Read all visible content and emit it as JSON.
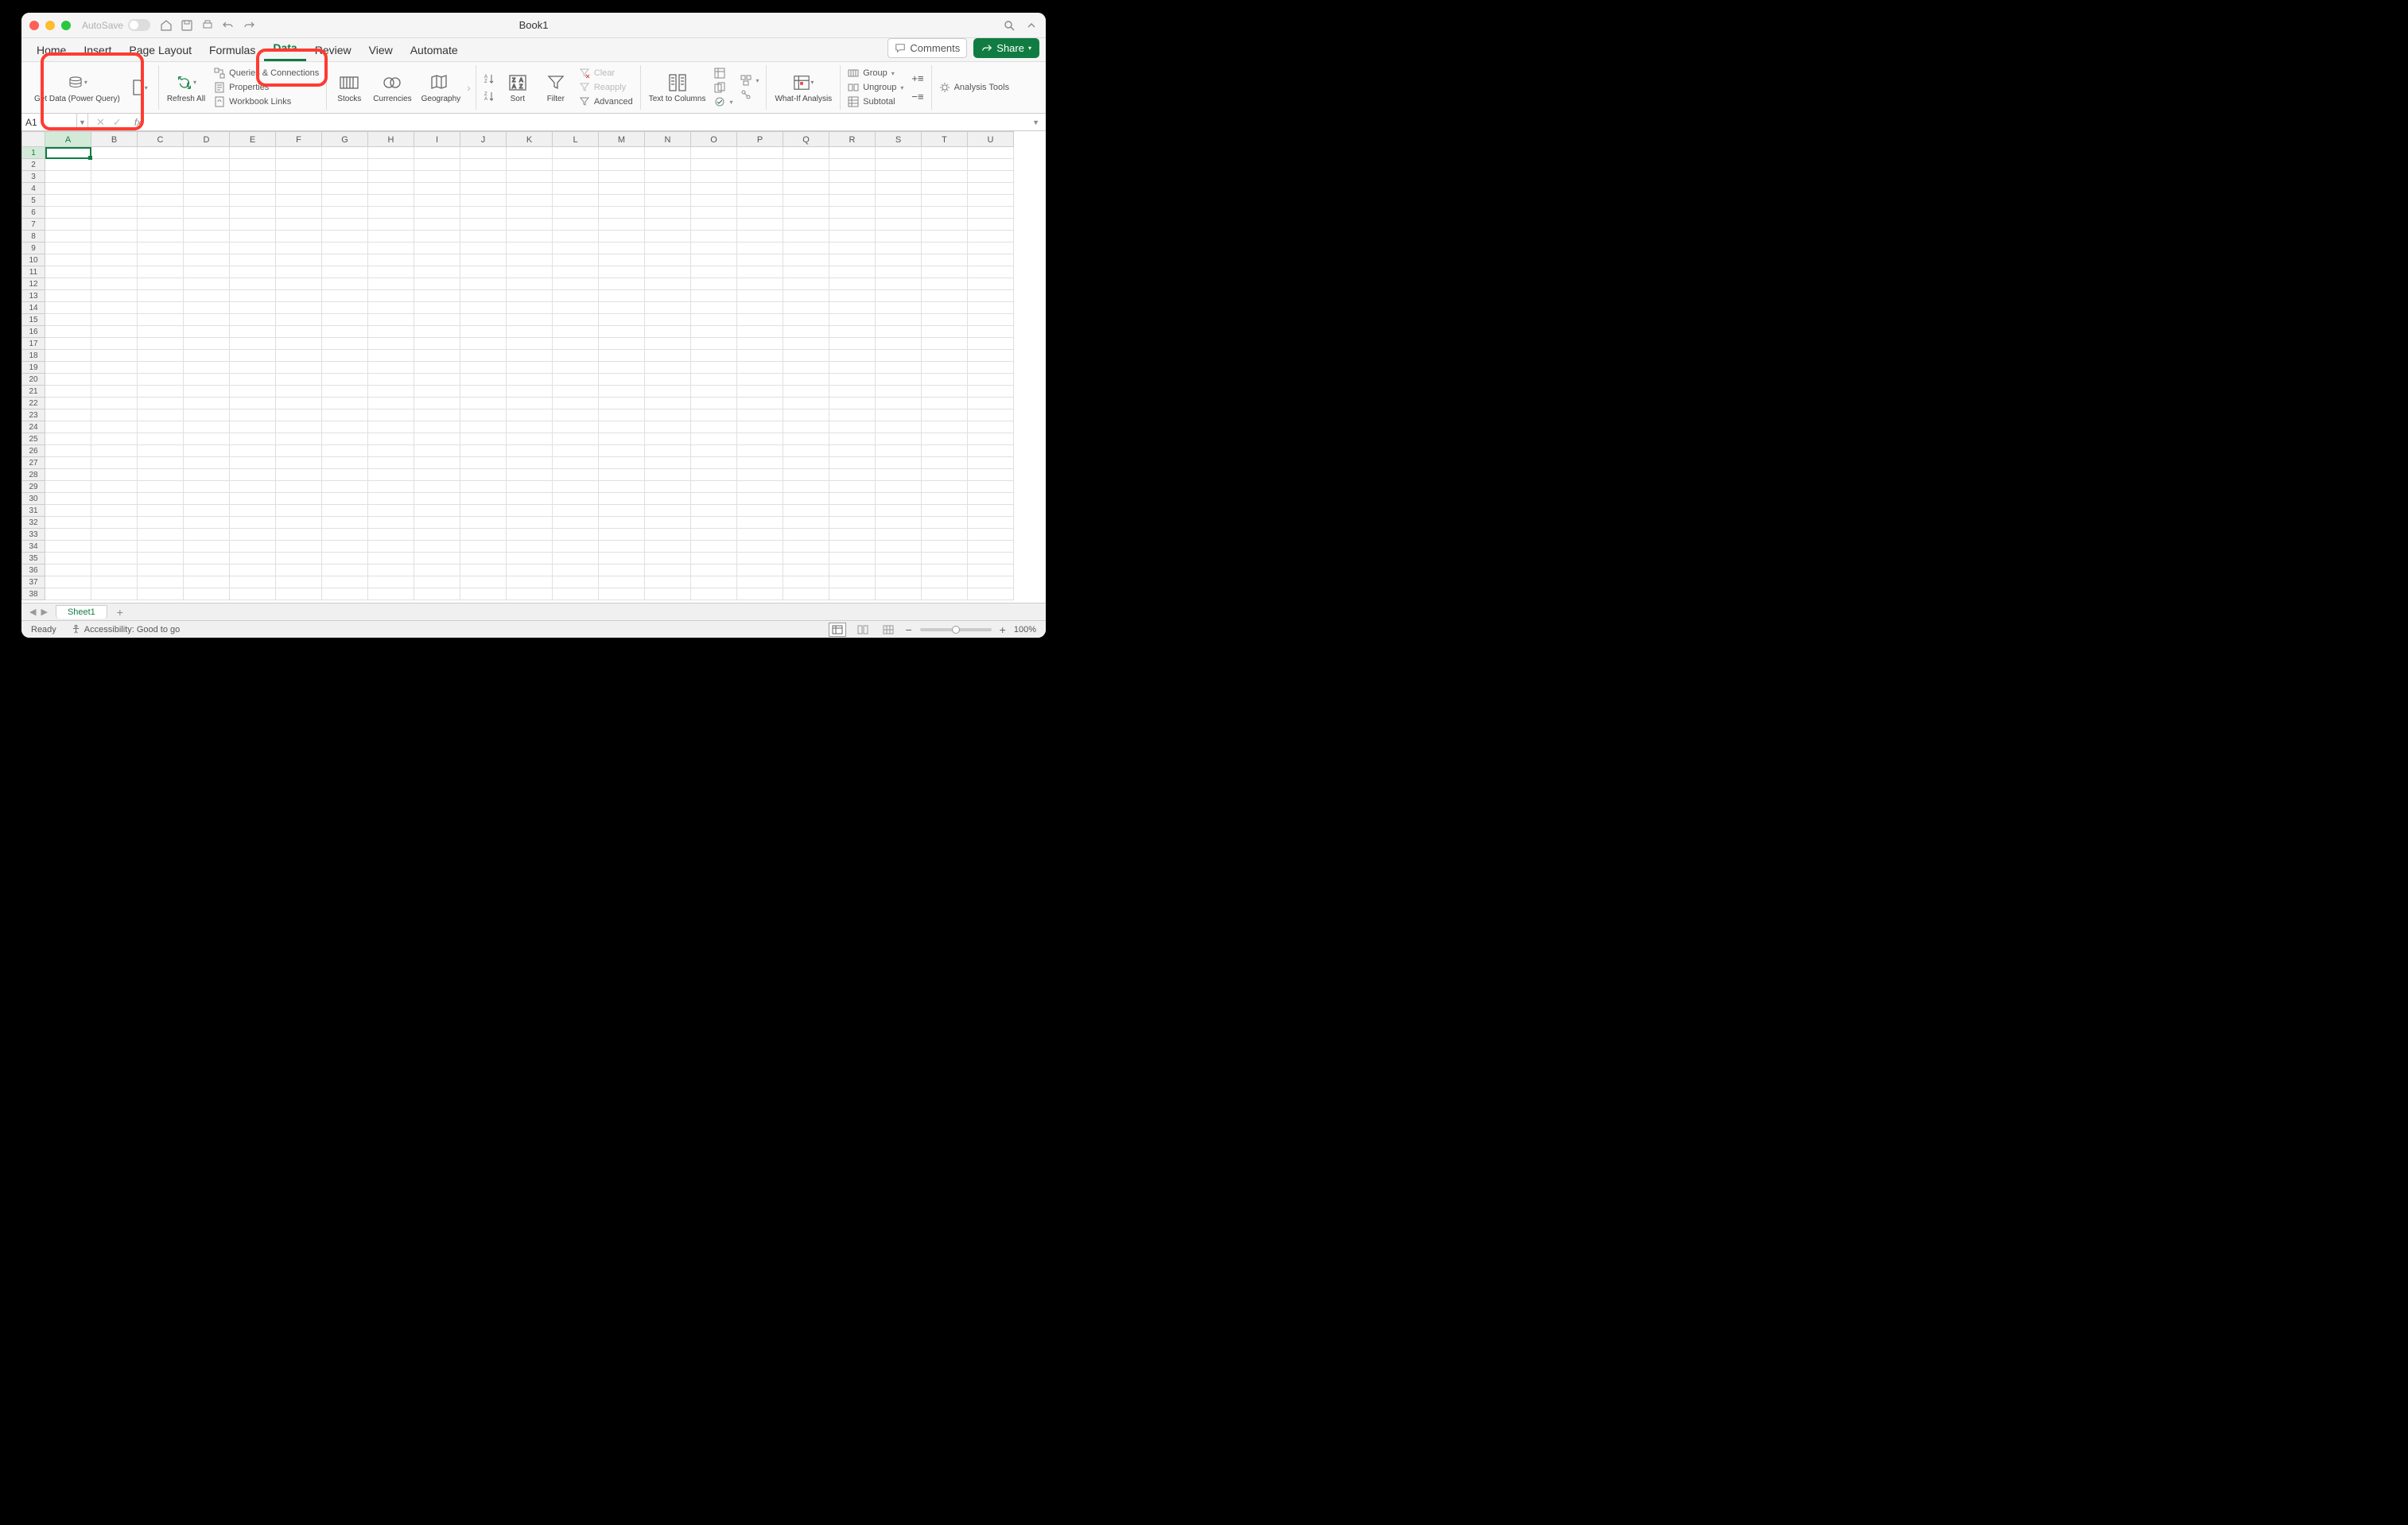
{
  "window": {
    "title": "Book1"
  },
  "titlebar": {
    "autosave": "AutoSave"
  },
  "tabs": {
    "items": [
      "Home",
      "Insert",
      "Page Layout",
      "Formulas",
      "Data",
      "Review",
      "View",
      "Automate"
    ],
    "active_index": 4,
    "comments": "Comments",
    "share": "Share"
  },
  "ribbon": {
    "get_data": "Get Data (Power Query)",
    "refresh_all": "Refresh All",
    "queries_connections": "Queries & Connections",
    "properties": "Properties",
    "workbook_links": "Workbook Links",
    "stocks": "Stocks",
    "currencies": "Currencies",
    "geography": "Geography",
    "sort": "Sort",
    "filter": "Filter",
    "clear": "Clear",
    "reapply": "Reapply",
    "advanced": "Advanced",
    "text_to_columns": "Text to Columns",
    "what_if": "What-If Analysis",
    "group": "Group",
    "ungroup": "Ungroup",
    "subtotal": "Subtotal",
    "analysis_tools": "Analysis Tools"
  },
  "formula_bar": {
    "name_box": "A1",
    "formula": ""
  },
  "grid": {
    "columns": [
      "A",
      "B",
      "C",
      "D",
      "E",
      "F",
      "G",
      "H",
      "I",
      "J",
      "K",
      "L",
      "M",
      "N",
      "O",
      "P",
      "Q",
      "R",
      "S",
      "T",
      "U"
    ],
    "rows": 38,
    "selected_cell": "A1"
  },
  "sheet_tabs": {
    "active": "Sheet1"
  },
  "status": {
    "ready": "Ready",
    "accessibility": "Accessibility: Good to go",
    "zoom": "100%"
  }
}
